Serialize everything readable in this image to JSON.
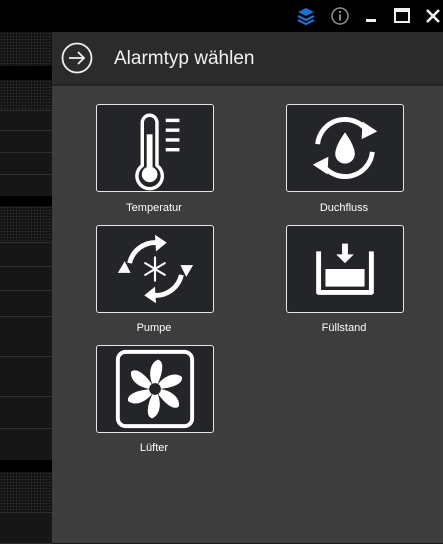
{
  "dialog": {
    "title": "Alarmtyp wählen"
  },
  "window_controls": {
    "layers_color": "#1f6fd1"
  },
  "alarm_types": [
    {
      "label": "Temperatur",
      "icon": "thermometer-icon"
    },
    {
      "label": "Duchfluss",
      "icon": "water-drop-cycle-icon"
    },
    {
      "label": "Pumpe",
      "icon": "snowflake-cycle-icon"
    },
    {
      "label": "Füllstand",
      "icon": "tank-level-icon"
    },
    {
      "label": "Lüfter",
      "icon": "fan-icon"
    }
  ]
}
